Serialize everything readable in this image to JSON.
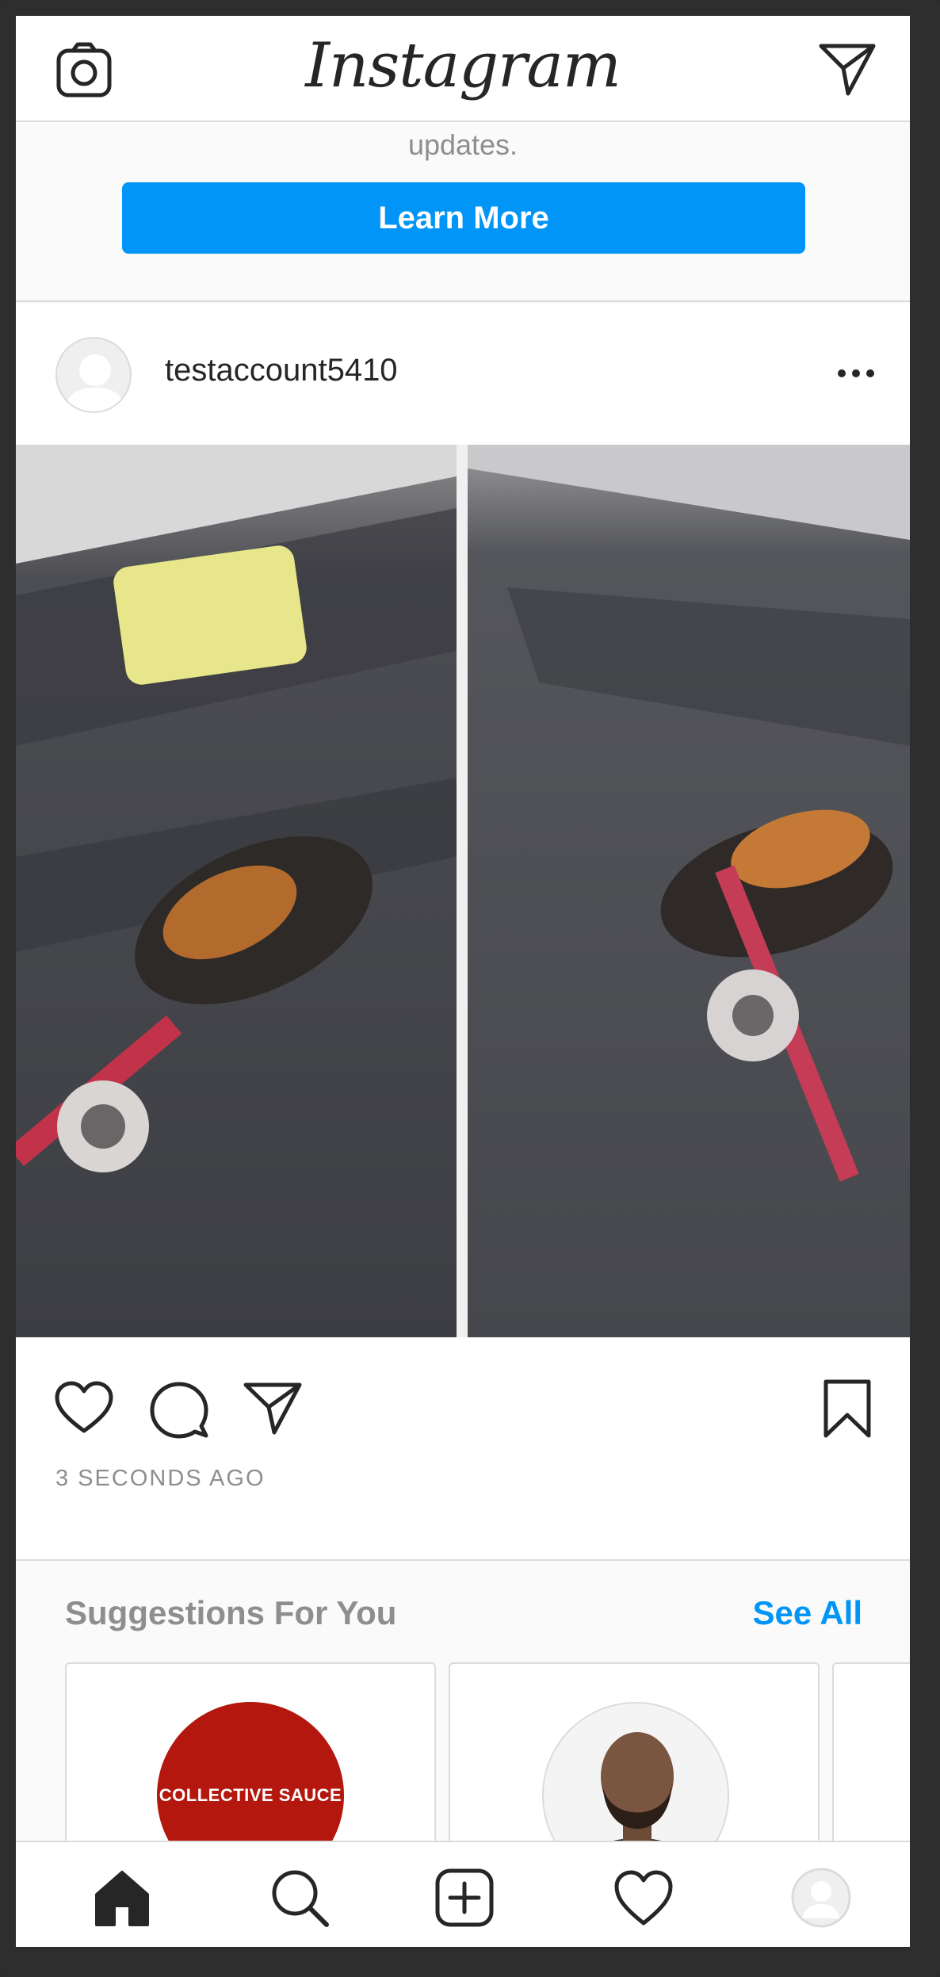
{
  "header": {
    "logo_text": "Instagram",
    "camera_icon": "camera-icon",
    "dm_icon": "direct-message-icon"
  },
  "promo": {
    "text": "updates.",
    "button_label": "Learn More"
  },
  "post": {
    "username": "testaccount5410",
    "more_icon": "more-options-icon",
    "timestamp": "3 SECONDS AGO",
    "actions": [
      "heart-icon",
      "comment-icon",
      "share-icon",
      "bookmark-icon"
    ]
  },
  "suggestions": {
    "title": "Suggestions For You",
    "see_all": "See All",
    "cards": [
      {
        "logo_text": "COLLECTIVE SAUCE"
      },
      {
        "logo_text": ""
      }
    ]
  },
  "tabbar": {
    "items": [
      "home-icon",
      "search-icon",
      "new-post-icon",
      "activity-icon",
      "profile-icon"
    ]
  },
  "colors": {
    "accent": "#0095f6",
    "text": "#262626",
    "muted": "#8e8e8e",
    "border": "#dbdbdb",
    "brand_red": "#b3170d"
  }
}
